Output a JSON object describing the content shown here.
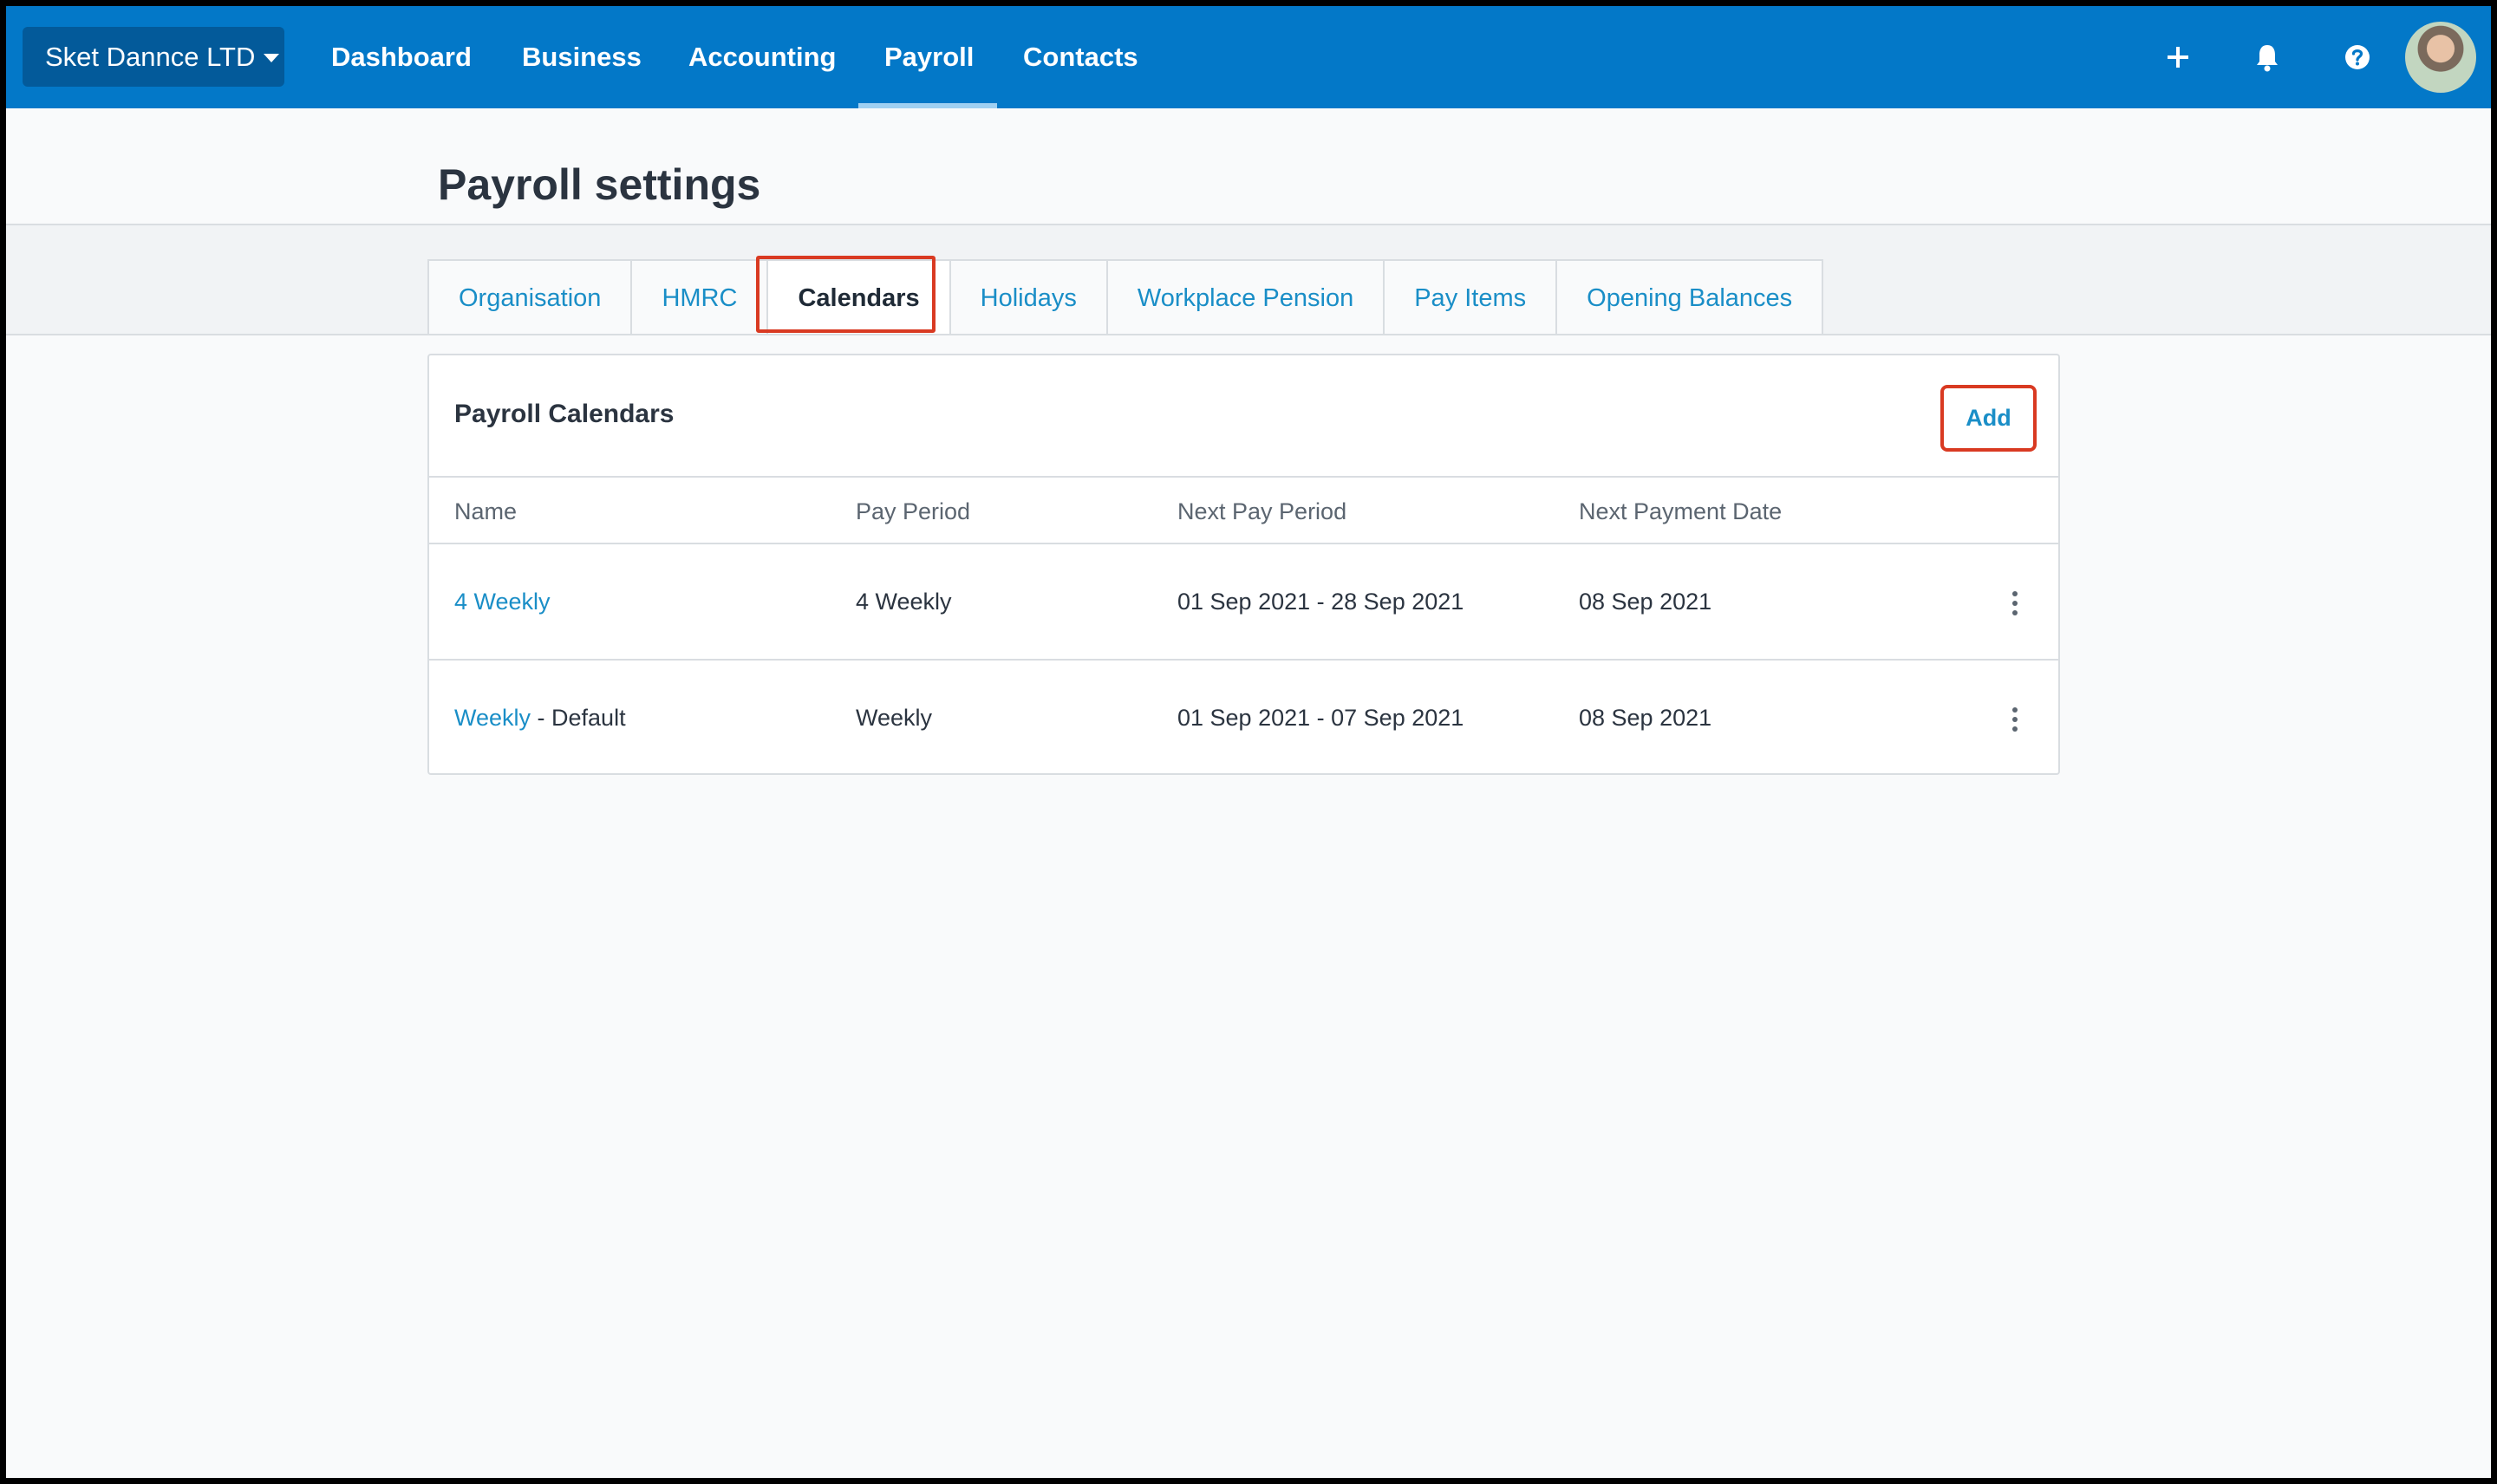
{
  "topnav": {
    "org_name": "Sket Dannce LTD",
    "items": [
      {
        "label": "Dashboard"
      },
      {
        "label": "Business"
      },
      {
        "label": "Accounting"
      },
      {
        "label": "Payroll",
        "active": true
      },
      {
        "label": "Contacts"
      }
    ],
    "icons": [
      "plus-icon",
      "bell-icon",
      "help-icon",
      "avatar"
    ]
  },
  "page": {
    "title": "Payroll settings"
  },
  "tabs": [
    {
      "label": "Organisation"
    },
    {
      "label": "HMRC"
    },
    {
      "label": "Calendars",
      "active": true
    },
    {
      "label": "Holidays"
    },
    {
      "label": "Workplace Pension"
    },
    {
      "label": "Pay Items"
    },
    {
      "label": "Opening Balances"
    }
  ],
  "calendars": {
    "title": "Payroll Calendars",
    "add_label": "Add",
    "columns": [
      "Name",
      "Pay Period",
      "Next Pay Period",
      "Next Payment Date"
    ],
    "rows": [
      {
        "name": "4 Weekly",
        "suffix": "",
        "pay_period": "4 Weekly",
        "next_pay_period": "01 Sep 2021 - 28 Sep 2021",
        "next_payment_date": "08 Sep 2021"
      },
      {
        "name": "Weekly",
        "suffix": " - Default",
        "pay_period": "Weekly",
        "next_pay_period": "01 Sep 2021 - 07 Sep 2021",
        "next_payment_date": "08 Sep 2021"
      }
    ]
  },
  "colors": {
    "nav_bg": "#0378c8",
    "link": "#1a8ec7",
    "highlight": "#d93a22"
  }
}
